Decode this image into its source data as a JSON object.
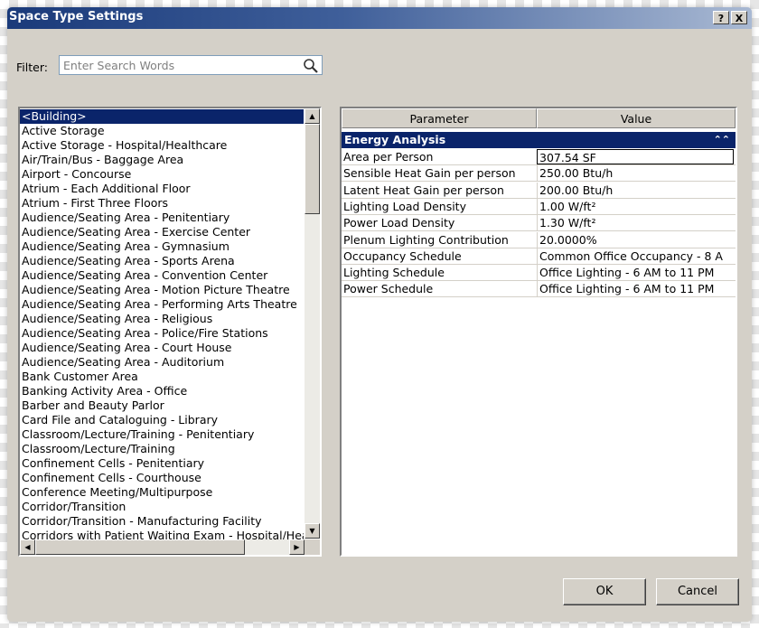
{
  "window": {
    "title": "Space Type Settings",
    "help_label": "?",
    "close_label": "X"
  },
  "filter": {
    "label": "Filter:",
    "placeholder": "Enter Search Words",
    "value": ""
  },
  "space_types": [
    {
      "label": "<Building>",
      "selected": true
    },
    {
      "label": "Active Storage"
    },
    {
      "label": "Active Storage - Hospital/Healthcare"
    },
    {
      "label": "Air/Train/Bus - Baggage Area"
    },
    {
      "label": "Airport - Concourse"
    },
    {
      "label": "Atrium - Each Additional Floor"
    },
    {
      "label": "Atrium - First Three Floors"
    },
    {
      "label": "Audience/Seating Area - Penitentiary"
    },
    {
      "label": "Audience/Seating Area - Exercise Center"
    },
    {
      "label": "Audience/Seating Area - Gymnasium"
    },
    {
      "label": "Audience/Seating Area - Sports Arena"
    },
    {
      "label": "Audience/Seating Area - Convention Center"
    },
    {
      "label": "Audience/Seating Area - Motion Picture Theatre"
    },
    {
      "label": "Audience/Seating Area - Performing Arts Theatre"
    },
    {
      "label": "Audience/Seating Area - Religious"
    },
    {
      "label": "Audience/Seating Area - Police/Fire Stations"
    },
    {
      "label": "Audience/Seating Area - Court House"
    },
    {
      "label": "Audience/Seating Area - Auditorium"
    },
    {
      "label": "Bank Customer Area"
    },
    {
      "label": "Banking Activity Area - Office"
    },
    {
      "label": "Barber and Beauty Parlor"
    },
    {
      "label": "Card File and Cataloguing - Library"
    },
    {
      "label": "Classroom/Lecture/Training - Penitentiary"
    },
    {
      "label": "Classroom/Lecture/Training"
    },
    {
      "label": "Confinement Cells - Penitentiary"
    },
    {
      "label": "Confinement Cells - Courthouse"
    },
    {
      "label": "Conference Meeting/Multipurpose"
    },
    {
      "label": "Corridor/Transition"
    },
    {
      "label": "Corridor/Transition - Manufacturing Facility"
    },
    {
      "label": "Corridors with Patient Waiting Exam - Hospital/Healthcare"
    }
  ],
  "grid": {
    "col_parameter": "Parameter",
    "col_value": "Value",
    "group": "Energy Analysis",
    "rows": [
      {
        "name": "Area per Person",
        "value": "307.54 SF"
      },
      {
        "name": "Sensible Heat Gain per person",
        "value": "250.00 Btu/h"
      },
      {
        "name": "Latent Heat Gain per person",
        "value": "200.00 Btu/h"
      },
      {
        "name": "Lighting Load Density",
        "value": "1.00 W/ft²"
      },
      {
        "name": "Power Load Density",
        "value": "1.30 W/ft²"
      },
      {
        "name": "Plenum Lighting Contribution",
        "value": "20.0000%"
      },
      {
        "name": "Occupancy Schedule",
        "value": "Common Office Occupancy - 8 A"
      },
      {
        "name": "Lighting Schedule",
        "value": "Office Lighting - 6 AM to 11 PM"
      },
      {
        "name": "Power Schedule",
        "value": "Office Lighting - 6 AM to 11 PM"
      }
    ]
  },
  "buttons": {
    "ok": "OK",
    "cancel": "Cancel"
  },
  "icons": {
    "search": "search-icon",
    "scroll_up": "arrow-up-icon",
    "scroll_down": "arrow-down-icon",
    "scroll_left": "arrow-left-icon",
    "scroll_right": "arrow-right-icon",
    "collapse": "double-chevron-up-icon"
  }
}
